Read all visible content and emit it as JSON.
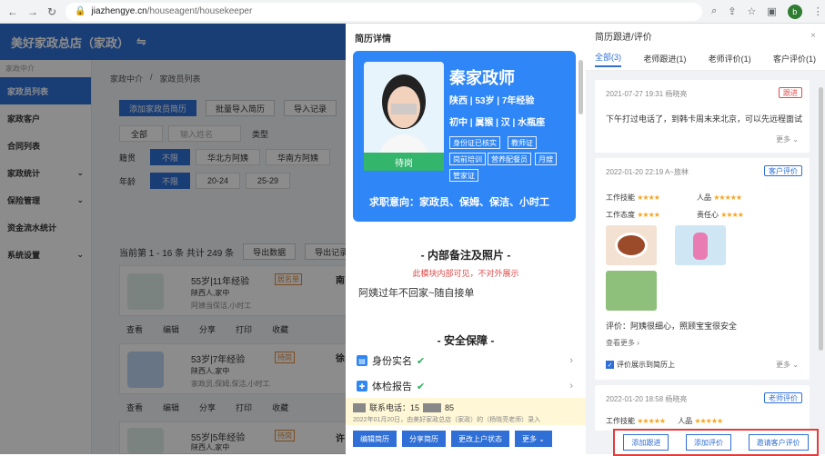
{
  "browser": {
    "url_host": "jiazhengye.cn",
    "url_path": "/houseagent/housekeeper",
    "avatar": "b"
  },
  "app": {
    "title": "美好家政总店（家政）"
  },
  "sidebar": {
    "section": "家政中介",
    "items": [
      {
        "label": "家政员列表",
        "active": true
      },
      {
        "label": "家政客户"
      },
      {
        "label": "合同列表"
      },
      {
        "label": "家政统计",
        "arrow": true
      },
      {
        "label": "保险管理",
        "arrow": true
      },
      {
        "label": "资金流水统计"
      },
      {
        "label": "系统设置",
        "arrow": true
      }
    ]
  },
  "main": {
    "breadcrumb": [
      "家政中介",
      "家政员列表"
    ],
    "add_btn": "添加家政员简历",
    "batch_btn": "批量导入简历",
    "import_btn": "导入记录",
    "search_placeholder": "输入姓名",
    "type_label": "类型",
    "all_label": "全部",
    "origin_label": "籍贯",
    "origin_chips": [
      "不限",
      "华北方阿姨",
      "华南方阿姨"
    ],
    "age_label": "年龄",
    "age_chips": [
      "不限",
      "20-24",
      "25-29"
    ],
    "pager": "当前第 1 - 16 条  共计 249 条",
    "export_btn": "导出数据",
    "export_log_btn": "导出记录",
    "cards": [
      {
        "info": "55岁|11年经验",
        "loc": "陕西人,家中",
        "badge": "居名单",
        "note": "阿姨当保洁,小时工"
      },
      {
        "info": "53岁|7年经验",
        "loc": "陕西人,家中",
        "badge": "待岗",
        "note": "家政员,保姆,保洁,小时工"
      },
      {
        "info": "55岁|5年经验",
        "loc": "陕西人,家中",
        "badge": "待岗"
      }
    ],
    "card_actions": [
      "查看",
      "编辑",
      "分享",
      "打印",
      "收藏"
    ],
    "side_names": [
      "南",
      "徐",
      "许"
    ]
  },
  "modal": {
    "title": "简历详情",
    "name": "秦家政师",
    "line1": "陕西 | 53岁 | 7年经验",
    "line2": "初中 | 属猴 | 汉 | 水瓶座",
    "tags": [
      "身份证已核实",
      "教师证",
      "岗前培训",
      "营养配餐员",
      "月嫂",
      "管家证"
    ],
    "status": "待岗",
    "intent": "求职意向：家政员、保姆、保洁、小时工",
    "internal_title": "- 内部备注及照片 -",
    "internal_note": "此模块内部可见，不对外展示",
    "remark": "阿姨过年不回家~随自接单",
    "safety_title": "- 安全保障 -",
    "id_label": "身份实名",
    "health_label": "体检报告",
    "contact": "联系电话：15",
    "contact_tail": "85",
    "footer_note": "2022年01月20日，由美好家政总店（家政）的（杨晓亮老师）录入",
    "btns": [
      "编辑简历",
      "分享简历",
      "更改上户状态",
      "更多"
    ]
  },
  "rpanel": {
    "title": "简历跟进/评价",
    "tabs": [
      "全部(3)",
      "老师跟进(1)",
      "老师评价(1)",
      "客户评价(1)"
    ],
    "entries": [
      {
        "time": "2021-07-27 19:31 杨晓亮",
        "badge": "跟进",
        "text": "下午打过电话了，到韩卡周末来北京，可以先远程面试",
        "more": "更多"
      },
      {
        "time": "2022-01-20 22:19 A~旅林",
        "badge": "客户评价",
        "rating_labels": [
          "工作技能",
          "人品",
          "工作态度",
          "责任心"
        ],
        "comment": "评价：阿姨很细心，照顾宝宝很安全",
        "show_more": "查看更多",
        "check": "评价展示到简历上",
        "more": "更多"
      },
      {
        "time": "2022-01-20 18:58 杨晓亮",
        "badge": "老师评价",
        "rating_labels": [
          "工作技能",
          "人品"
        ]
      }
    ],
    "footer_btns": [
      "添加跟进",
      "添加评价",
      "邀请客户评价"
    ]
  },
  "colors": {
    "primary": "#2f6fd6",
    "card_blue": "#2f86f6",
    "badge_red": "#e04b4b",
    "highlight": "#e43b3b"
  }
}
